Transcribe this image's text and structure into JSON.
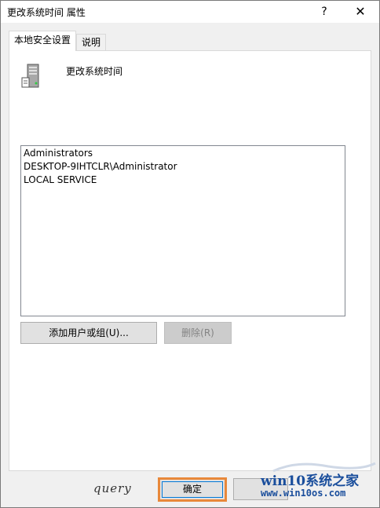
{
  "window": {
    "title": "更改系统时间 属性",
    "help_glyph": "?",
    "close_glyph": "✕"
  },
  "tabs": [
    {
      "label": "本地安全设置",
      "active": true
    },
    {
      "label": "说明",
      "active": false
    }
  ],
  "policy": {
    "name": "更改系统时间",
    "icon": "server-policy-icon"
  },
  "members": {
    "items": [
      "Administrators",
      "DESKTOP-9IHTCLR\\Administrator",
      "LOCAL SERVICE"
    ]
  },
  "buttons": {
    "add_label": "添加用户或组(U)...",
    "remove_label": "删除(R)",
    "ok_label": "确定"
  },
  "signature": {
    "text": "query"
  },
  "watermark": {
    "line1": "win10系统之家",
    "line2": "www.win10os.com"
  },
  "colors": {
    "ok_highlight": "#e8883a",
    "watermark_text": "#1a4e9c"
  }
}
